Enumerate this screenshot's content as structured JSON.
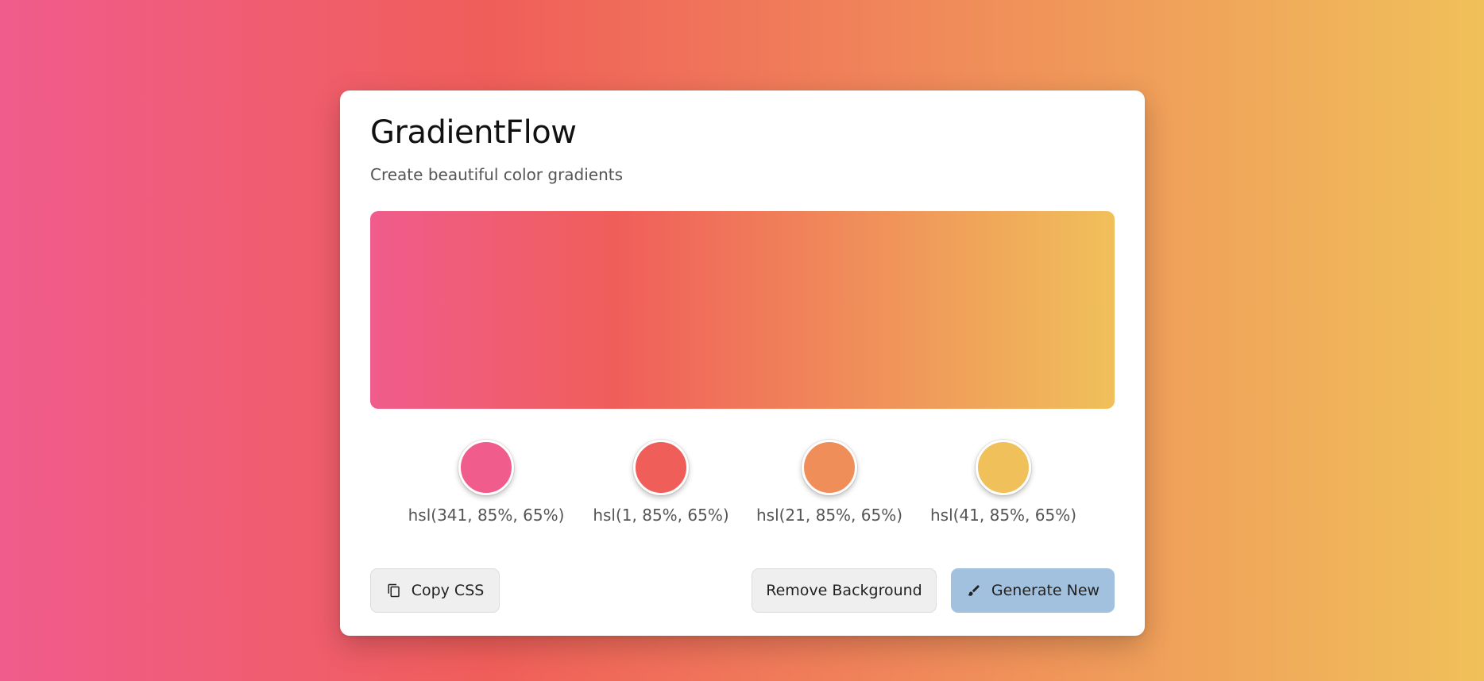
{
  "app": {
    "title": "GradientFlow",
    "subtitle": "Create beautiful color gradients"
  },
  "colors": {
    "stops": [
      "#f05c8c",
      "#f05e5a",
      "#f08e5a",
      "#f0c05a"
    ],
    "card_background": "#ffffff",
    "primary_button": "#a2c1df"
  },
  "swatches": [
    {
      "label": "hsl(341, 85%, 65%)",
      "color": "#f05c8c"
    },
    {
      "label": "hsl(1, 85%, 65%)",
      "color": "#f05e5a"
    },
    {
      "label": "hsl(21, 85%, 65%)",
      "color": "#f08e5a"
    },
    {
      "label": "hsl(41, 85%, 65%)",
      "color": "#f0c05a"
    }
  ],
  "actions": {
    "copy_label": "Copy CSS",
    "copy_icon": "copy-icon",
    "remove_label": "Remove Background",
    "generate_label": "Generate New",
    "generate_icon": "brush-icon"
  }
}
